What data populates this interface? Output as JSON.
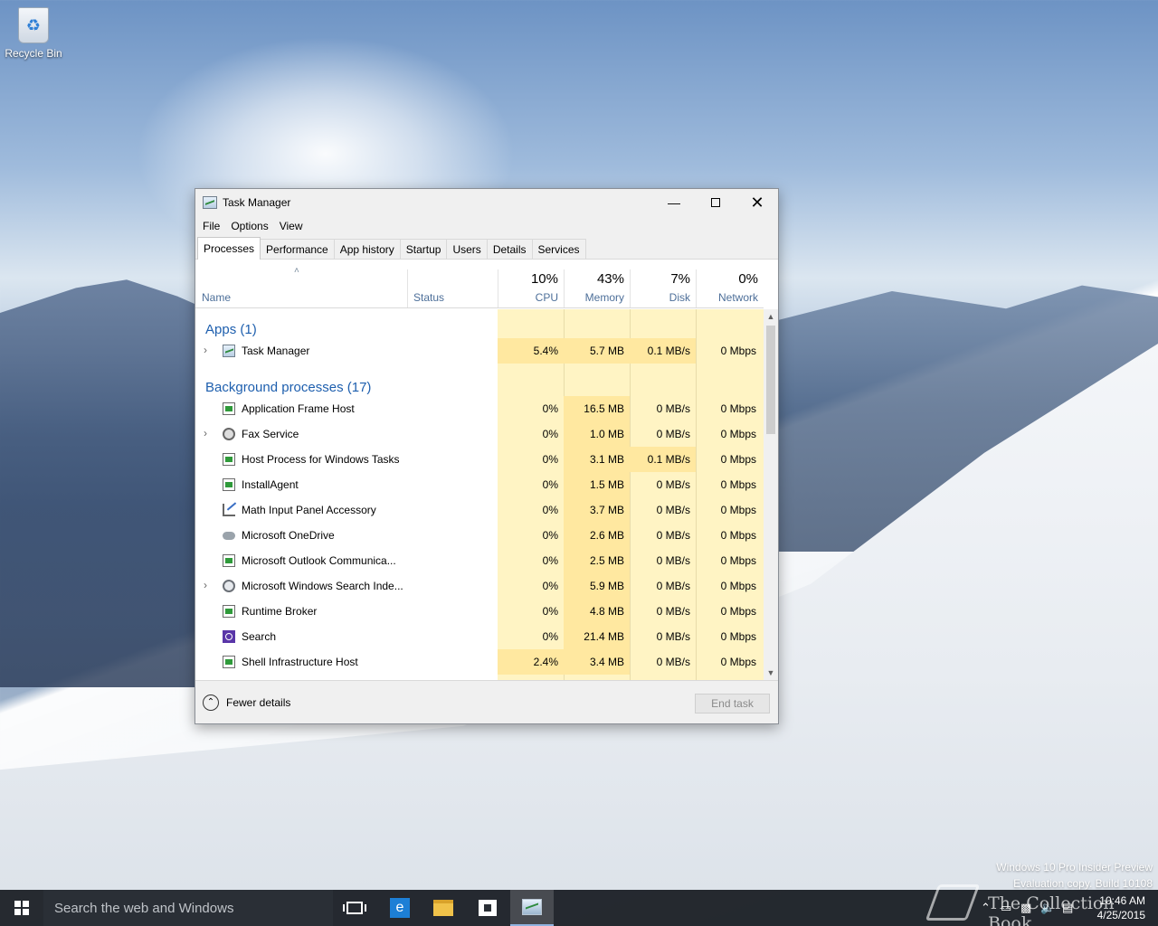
{
  "desktop": {
    "recycle_bin_label": "Recycle Bin",
    "watermark_line1": "Windows 10 Pro Insider Preview",
    "watermark_line2": "Evaluation copy. Build 10108",
    "watermark_brand": "The Collection Book"
  },
  "window": {
    "title": "Task Manager",
    "controls": {
      "minimize": "—",
      "close": "✕"
    }
  },
  "menu": [
    "File",
    "Options",
    "View"
  ],
  "tabs": [
    "Processes",
    "Performance",
    "App history",
    "Startup",
    "Users",
    "Details",
    "Services"
  ],
  "active_tab": "Processes",
  "columns": {
    "name": "Name",
    "status": "Status",
    "cpu": {
      "label": "CPU",
      "total": "10%"
    },
    "memory": {
      "label": "Memory",
      "total": "43%"
    },
    "disk": {
      "label": "Disk",
      "total": "7%"
    },
    "network": {
      "label": "Network",
      "total": "0%"
    },
    "sort_caret": "˄"
  },
  "groups": {
    "apps": "Apps (1)",
    "background": "Background processes (17)"
  },
  "apps": [
    {
      "name": "Task Manager",
      "icon": "task-manager-icon",
      "expandable": true,
      "cpu": "5.4%",
      "memory": "5.7 MB",
      "disk": "0.1 MB/s",
      "network": "0 Mbps"
    }
  ],
  "background": [
    {
      "name": "Application Frame Host",
      "icon": "app-window-icon",
      "expandable": false,
      "cpu": "0%",
      "memory": "16.5 MB",
      "disk": "0 MB/s",
      "network": "0 Mbps"
    },
    {
      "name": "Fax Service",
      "icon": "fax-icon",
      "expandable": true,
      "cpu": "0%",
      "memory": "1.0 MB",
      "disk": "0 MB/s",
      "network": "0 Mbps"
    },
    {
      "name": "Host Process for Windows Tasks",
      "icon": "app-window-icon",
      "expandable": false,
      "cpu": "0%",
      "memory": "3.1 MB",
      "disk": "0.1 MB/s",
      "network": "0 Mbps"
    },
    {
      "name": "InstallAgent",
      "icon": "app-window-icon",
      "expandable": false,
      "cpu": "0%",
      "memory": "1.5 MB",
      "disk": "0 MB/s",
      "network": "0 Mbps"
    },
    {
      "name": "Math Input Panel Accessory",
      "icon": "math-input-icon",
      "expandable": false,
      "cpu": "0%",
      "memory": "3.7 MB",
      "disk": "0 MB/s",
      "network": "0 Mbps"
    },
    {
      "name": "Microsoft OneDrive",
      "icon": "onedrive-cloud-icon",
      "expandable": false,
      "cpu": "0%",
      "memory": "2.6 MB",
      "disk": "0 MB/s",
      "network": "0 Mbps"
    },
    {
      "name": "Microsoft Outlook Communica...",
      "icon": "app-window-icon",
      "expandable": false,
      "cpu": "0%",
      "memory": "2.5 MB",
      "disk": "0 MB/s",
      "network": "0 Mbps"
    },
    {
      "name": "Microsoft Windows Search Inde...",
      "icon": "search-indexer-icon",
      "expandable": true,
      "cpu": "0%",
      "memory": "5.9 MB",
      "disk": "0 MB/s",
      "network": "0 Mbps"
    },
    {
      "name": "Runtime Broker",
      "icon": "app-window-icon",
      "expandable": false,
      "cpu": "0%",
      "memory": "4.8 MB",
      "disk": "0 MB/s",
      "network": "0 Mbps"
    },
    {
      "name": "Search",
      "icon": "cortana-icon",
      "expandable": false,
      "cpu": "0%",
      "memory": "21.4 MB",
      "disk": "0 MB/s",
      "network": "0 Mbps"
    },
    {
      "name": "Shell Infrastructure Host",
      "icon": "app-window-icon",
      "expandable": false,
      "cpu": "2.4%",
      "memory": "3.4 MB",
      "disk": "0 MB/s",
      "network": "0 Mbps"
    }
  ],
  "footer": {
    "fewer_details": "Fewer details",
    "end_task": "End task"
  },
  "taskbar": {
    "search_placeholder": "Search the web and Windows",
    "clock_time": "10:46 AM",
    "clock_date": "4/25/2015"
  }
}
